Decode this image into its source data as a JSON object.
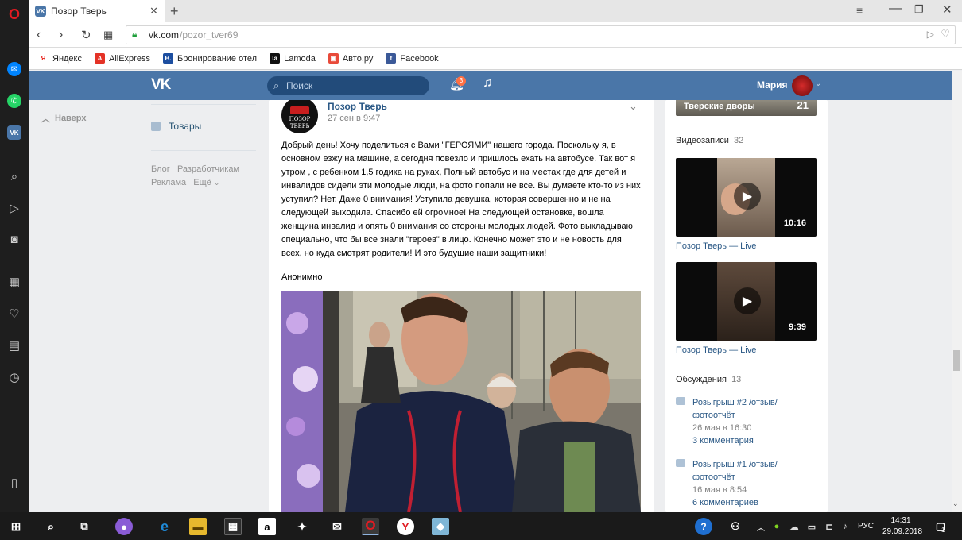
{
  "browser": {
    "tab_title": "Позор Тверь",
    "new_tab": "+",
    "url_host": "vk.com",
    "url_path": "/pozor_tver69",
    "bookmarks": [
      {
        "label": "Яндекс",
        "color": "#ffffff",
        "glyph": "Я",
        "fg": "#e8221b"
      },
      {
        "label": "AliExpress",
        "color": "#e43226",
        "glyph": "A",
        "fg": "#ffffff"
      },
      {
        "label": "Бронирование отел",
        "color": "#1c4ea0",
        "glyph": "B.",
        "fg": "#ffffff"
      },
      {
        "label": "Lamoda",
        "color": "#111111",
        "glyph": "la",
        "fg": "#ffffff"
      },
      {
        "label": "Авто.ру",
        "color": "#e84a3a",
        "glyph": "▣",
        "fg": "#ffffff"
      },
      {
        "label": "Facebook",
        "color": "#3b5998",
        "glyph": "f",
        "fg": "#ffffff"
      }
    ]
  },
  "vk": {
    "logo": "VK",
    "search_placeholder": "Поиск",
    "notif_count": "3",
    "user_name": "Мария",
    "left": {
      "back": "Наверх",
      "goods": "Товары",
      "footer": [
        "Блог",
        "Разработчикам",
        "Реклама",
        "Ещё"
      ]
    },
    "post": {
      "author": "Позор Тверь",
      "date": "27 сен в 9:47",
      "avatar_text": "ПОЗОР ТВЕРЬ",
      "text": "Добрый день! Хочу поделиться с Вами \"ГЕРОЯМИ\" нашего города. Поскольку я, в основном езжу на машине, а сегодня повезло и пришлось ехать на автобусе. Так вот я утром , с ребенком 1,5 годика на руках, Полный автобус и на местах где для детей и инвалидов сидели эти молодые люди, на фото попали не все. Вы думаете кто-то из них уступил? Нет. Даже 0 внимания! Уступила девушка, которая совершенно и не на следующей выходила. Спасибо ей огромное! На следующей остановке, вошла женщина инвалид и опять 0 внимания со стороны молодых людей. Фото выкладываю специально, что бы все знали \"героев\" в лицо. Конечно может это и не новость для всех, но куда смотрят родители! И это будущие наши защитники!",
      "signature": "Анонимно"
    },
    "right": {
      "album_label": "Тверские дворы",
      "album_count": "21",
      "videos_title": "Видеозаписи",
      "videos_count": "32",
      "videos": [
        {
          "duration": "10:16",
          "title": "Позор Тверь — Live"
        },
        {
          "duration": "9:39",
          "title": "Позор Тверь — Live"
        }
      ],
      "discussions_title": "Обсуждения",
      "discussions_count": "13",
      "discussions": [
        {
          "title1": "Розыгрыш #2 /отзыв/",
          "title2": "фотоотчёт",
          "date": "26 мая в 16:30",
          "comments": "3 комментария"
        },
        {
          "title1": "Розыгрыш #1 /отзыв/",
          "title2": "фотоотчёт",
          "date": "16 мая в 8:54",
          "comments": "6 комментариев"
        }
      ]
    }
  },
  "taskbar": {
    "lang": "РУС",
    "time": "14:31",
    "date": "29.09.2018",
    "notif": "1"
  },
  "colors": {
    "vk_blue": "#4a76a8",
    "link": "#2a5885",
    "opera_red": "#e11b22"
  }
}
